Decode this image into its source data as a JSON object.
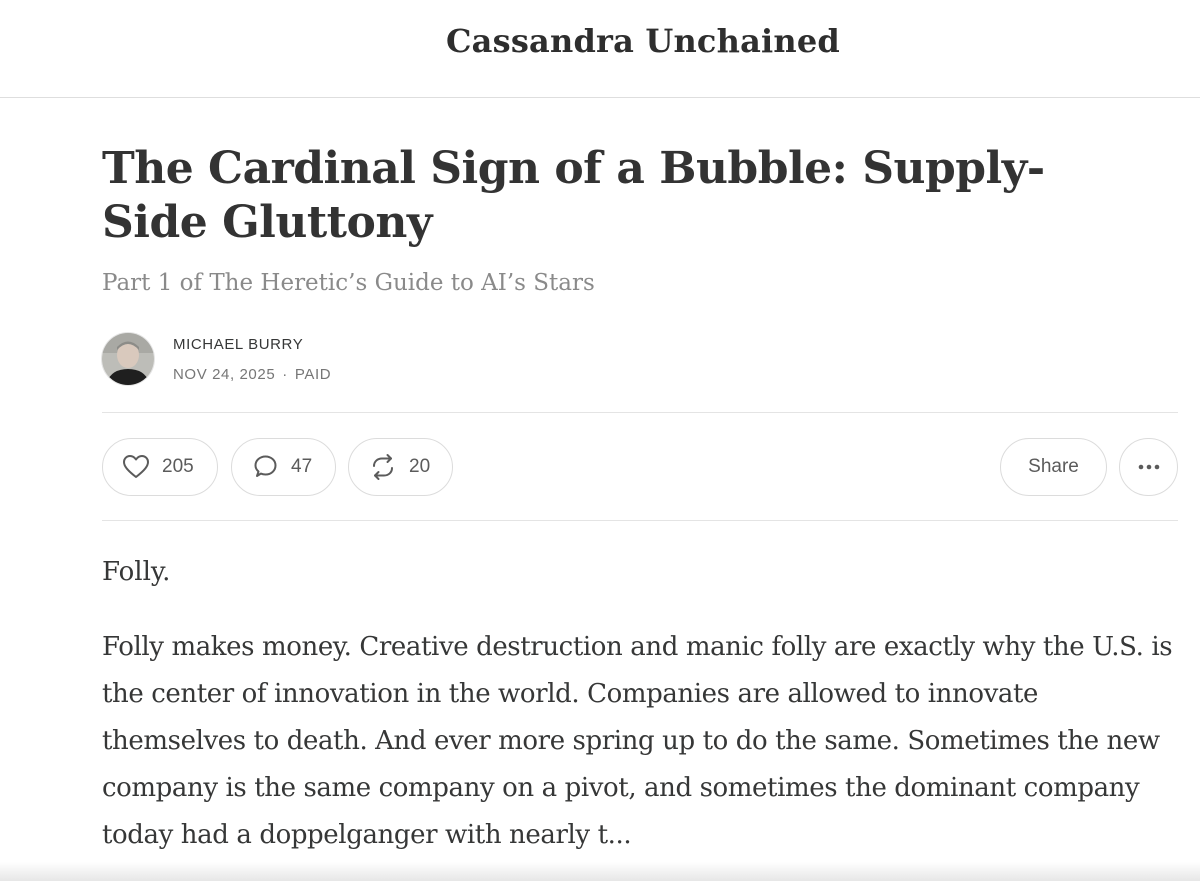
{
  "publication": {
    "name": "Cassandra Unchained"
  },
  "post": {
    "title": "The Cardinal Sign of a Bubble: Supply-Side Gluttony",
    "subtitle": "Part 1 of The Heretic’s Guide to AI’s Stars",
    "author": "MICHAEL BURRY",
    "date": "NOV 24, 2025",
    "separator": "·",
    "access": "PAID"
  },
  "actions": {
    "likes": "205",
    "comments": "47",
    "restacks": "20",
    "share_label": "Share",
    "more_label": "···"
  },
  "body": {
    "paragraphs": [
      "Folly.",
      "Folly makes money. Creative destruction and manic folly are exactly why the U.S. is the center of innovation in the world. Companies are allowed to innovate themselves to death. And ever more spring up to do the same. Sometimes the new company is the same company on a pivot, and sometimes the dominant company today had a doppelganger with nearly t..."
    ]
  },
  "icons": {
    "like": "heart-icon",
    "comment": "comment-bubble-icon",
    "restack": "restack-arrows-icon",
    "more": "more-dots-icon"
  },
  "colors": {
    "text": "#363737",
    "muted": "#8a8a8a",
    "border": "#dcdcdc"
  }
}
